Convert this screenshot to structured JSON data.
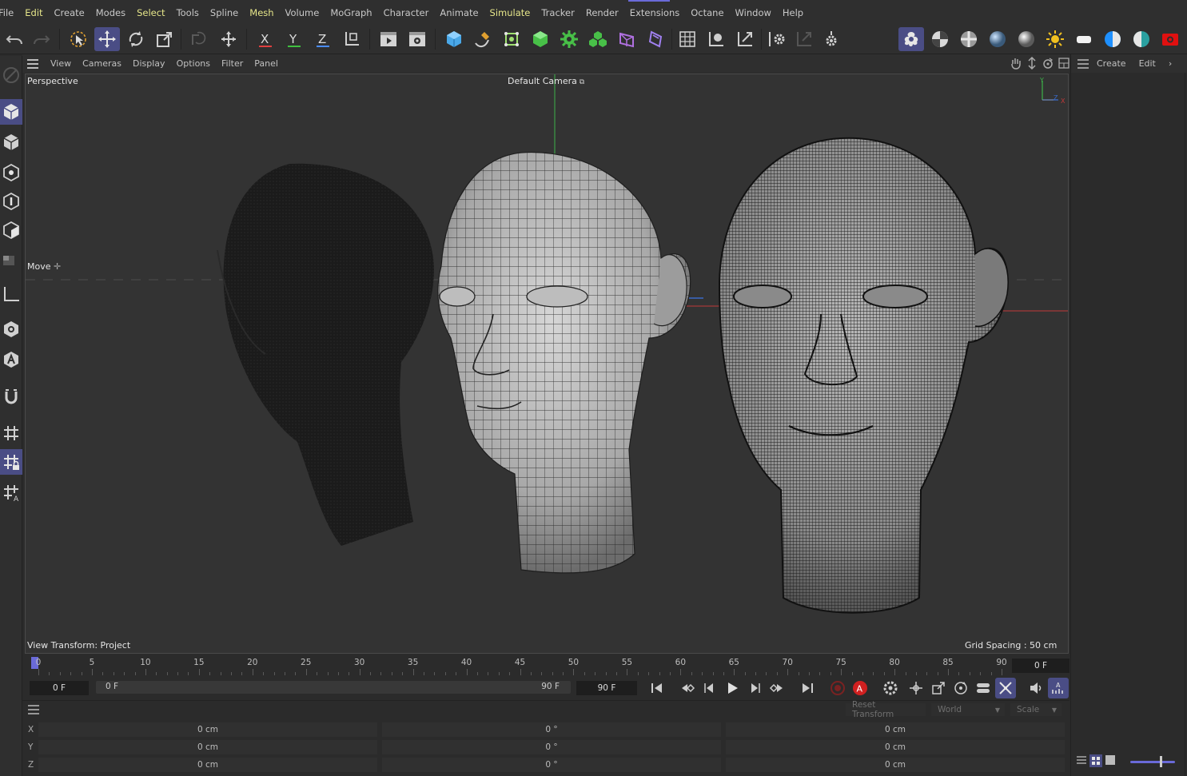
{
  "menu": [
    "File",
    "Edit",
    "Create",
    "Modes",
    "Select",
    "Tools",
    "Spline",
    "Mesh",
    "Volume",
    "MoGraph",
    "Character",
    "Animate",
    "Simulate",
    "Tracker",
    "Render",
    "Extensions",
    "Octane",
    "Window",
    "Help"
  ],
  "menu_highlight": [
    "Edit",
    "Select",
    "Mesh",
    "Simulate"
  ],
  "toolbar": {
    "axis_x": "X",
    "axis_y": "Y",
    "axis_z": "Z"
  },
  "viewport_menu": [
    "View",
    "Cameras",
    "Display",
    "Options",
    "Filter",
    "Panel"
  ],
  "viewport": {
    "name": "Perspective",
    "camera": "Default Camera",
    "tool": "Move",
    "view_transform": "View Transform: Project",
    "grid_spacing": "Grid Spacing : 50 cm",
    "gizmo_y": "Y",
    "gizmo_z": "Z",
    "gizmo_x": "X"
  },
  "right_panel": {
    "create": "Create",
    "edit": "Edit",
    "more": "›"
  },
  "timeline": {
    "ticks": [
      "0",
      "5",
      "10",
      "15",
      "20",
      "25",
      "30",
      "35",
      "40",
      "45",
      "50",
      "55",
      "60",
      "65",
      "70",
      "75",
      "80",
      "85",
      "90"
    ],
    "current_frame": "0 F"
  },
  "transport": {
    "start_field": "0 F",
    "range_start": "0 F",
    "range_end": "90 F",
    "end_field": "90 F"
  },
  "coordinates": {
    "reset": "Reset Transform",
    "space": "World",
    "mode": "Scale",
    "rows": [
      {
        "axis": "X",
        "pos": "0 cm",
        "rot": "0 °",
        "scale": "0 cm"
      },
      {
        "axis": "Y",
        "pos": "0 cm",
        "rot": "0 °",
        "scale": "0 cm"
      },
      {
        "axis": "Z",
        "pos": "0 cm",
        "rot": "0 °",
        "scale": "0 cm"
      }
    ]
  },
  "colors": {
    "accent": "#4a4d85",
    "accent_bright": "#6a6ad8",
    "axis_x": "#e04040",
    "axis_y": "#40c040",
    "axis_z": "#4a8cff"
  }
}
